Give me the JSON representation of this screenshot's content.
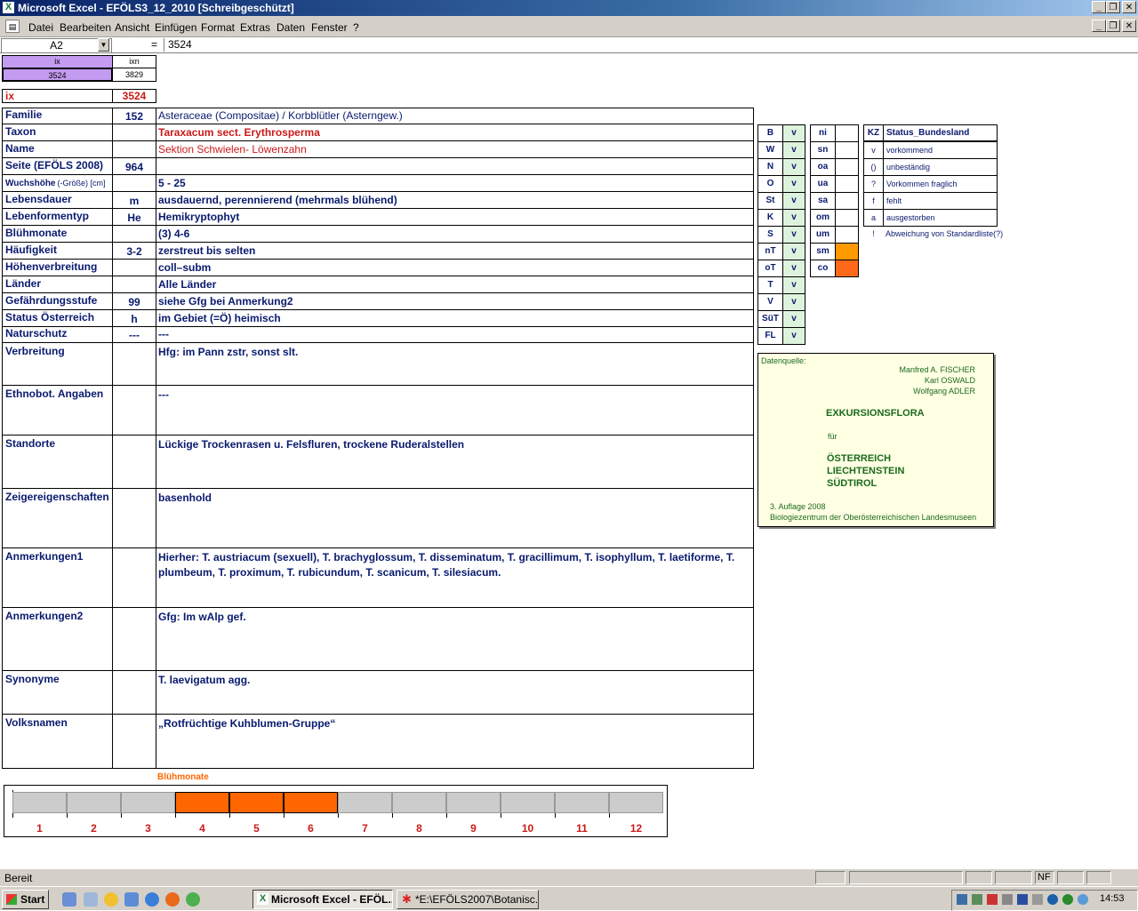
{
  "window": {
    "title": "Microsoft Excel - EFÖLS3_12_2010  [Schreibgeschützt]"
  },
  "menu": [
    "Datei",
    "Bearbeiten",
    "Ansicht",
    "Einfügen",
    "Format",
    "Extras",
    "Daten",
    "Fenster",
    "?"
  ],
  "formula_bar": {
    "name_box": "A2",
    "eq": "=",
    "value": "3524"
  },
  "index_box": {
    "h1": "ix",
    "h2": "ixn",
    "v1": "3524",
    "v2": "3829"
  },
  "ix_row": {
    "label": "ix",
    "value": "3524"
  },
  "rows": [
    {
      "label": "Familie",
      "code": "152",
      "value": "Asteraceae (Compositae)  /  Korbblütler (Asterngew.)"
    },
    {
      "label": "Taxon",
      "code": "",
      "value": "Taraxacum sect. Erythrosperma"
    },
    {
      "label": "Name",
      "code": "",
      "value": "Sektion Schwielen- Löwenzahn"
    },
    {
      "label": "Seite (EFÖLS 2008)",
      "code": "964",
      "value": ""
    },
    {
      "label": "Wuchshöhe",
      "label_suffix": "(-Größe) [cm]",
      "code": "",
      "value": " 5 - 25"
    },
    {
      "label": "Lebensdauer",
      "code": "m",
      "value": "ausdauernd, perennierend (mehrmals blühend)"
    },
    {
      "label": "Lebenformentyp",
      "code": "He",
      "value": "Hemikryptophyt"
    },
    {
      "label": "Blühmonate",
      "code": "",
      "value": "(3) 4-6"
    },
    {
      "label": "Häufigkeit",
      "code": "3-2",
      "value": "zerstreut bis selten"
    },
    {
      "label": "Höhenverbreitung",
      "code": "",
      "value": "coll–subm"
    },
    {
      "label": "Länder",
      "code": "",
      "value": "Alle Länder"
    },
    {
      "label": "Gefährdungsstufe",
      "code": "99",
      "value": "siehe Gfg bei Anmerkung2"
    },
    {
      "label": "Status Österreich",
      "code": "h",
      "value": "im Gebiet (=Ö) heimisch"
    },
    {
      "label": "Naturschutz",
      "code": "---",
      "value": "---"
    }
  ],
  "big_rows": [
    {
      "label": "Verbreitung",
      "value": "Hfg:  im Pann zstr, sonst slt."
    },
    {
      "label": "Ethnobot. Angaben",
      "value": "---"
    },
    {
      "label": "Standorte",
      "value": "Lückige Trockenrasen u. Felsfluren, trockene Ruderalstellen"
    },
    {
      "label": "Zeigereigenschaften",
      "value": "basenhold"
    },
    {
      "label": "Anmerkungen1",
      "value": "Hierher: T. austriacum (sexuell), T. brachyglossum, T. disseminatum, T. gracillimum, T. isophyllum, T. laetiforme, T.",
      "value2": "plumbeum, T. proximum, T. rubicundum, T. scanicum, T. silesiacum."
    },
    {
      "label": "Anmerkungen2",
      "value": "Gfg:  Im wAlp gef."
    },
    {
      "label": "Synonyme",
      "value": "T. laevigatum agg."
    },
    {
      "label": "Volksnamen",
      "value": "„Rotfrüchtige Kuhblumen-Gruppe“"
    }
  ],
  "status_left": [
    {
      "code": "B",
      "v": "v"
    },
    {
      "code": "W",
      "v": "v"
    },
    {
      "code": "N",
      "v": "v"
    },
    {
      "code": "O",
      "v": "v"
    },
    {
      "code": "St",
      "v": "v"
    },
    {
      "code": "K",
      "v": "v"
    },
    {
      "code": "S",
      "v": "v"
    },
    {
      "code": "nT",
      "v": "v"
    },
    {
      "code": "oT",
      "v": "v"
    },
    {
      "code": "T",
      "v": "v"
    },
    {
      "code": "V",
      "v": "v"
    },
    {
      "code": "SüT",
      "v": "v"
    },
    {
      "code": "FL",
      "v": "v"
    }
  ],
  "status_mid": [
    {
      "code": "ni",
      "fill": ""
    },
    {
      "code": "sn",
      "fill": ""
    },
    {
      "code": "oa",
      "fill": ""
    },
    {
      "code": "ua",
      "fill": ""
    },
    {
      "code": "sa",
      "fill": ""
    },
    {
      "code": "om",
      "fill": ""
    },
    {
      "code": "um",
      "fill": ""
    },
    {
      "code": "sm",
      "fill": "#ff9900"
    },
    {
      "code": "co",
      "fill": "#ff6a1a"
    }
  ],
  "legend": {
    "header_kz": "KZ",
    "header_title": "Status_Bundesland",
    "items": [
      {
        "k": "v",
        "t": "vorkommend"
      },
      {
        "k": "()",
        "t": "unbeständig"
      },
      {
        "k": "?",
        "t": "Vorkommen fraglich"
      },
      {
        "k": "f",
        "t": "fehlt"
      },
      {
        "k": "a",
        "t": "ausgestorben"
      },
      {
        "k": "!",
        "t": "Abweichung von Standardliste(?)"
      }
    ]
  },
  "source": {
    "label": "Datenquelle:",
    "authors": [
      "Manfred A. FISCHER",
      "Karl OSWALD",
      "Wolfgang ADLER"
    ],
    "title": "EXKURSIONSFLORA",
    "fuer": "für",
    "countries": [
      "ÖSTERREICH",
      "LIECHTENSTEIN",
      "SÜDTIROL"
    ],
    "edition": "3. Auflage 2008",
    "publisher": "Biologiezentrum der Oberösterreichischen Landesmuseen"
  },
  "bloom": {
    "title": "Blühmonate",
    "months": [
      "1",
      "2",
      "3",
      "4",
      "5",
      "6",
      "7",
      "8",
      "9",
      "10",
      "11",
      "12"
    ],
    "active": [
      false,
      false,
      false,
      true,
      true,
      true,
      false,
      false,
      false,
      false,
      false,
      false
    ],
    "colors": {
      "active": "#ff6600",
      "inactive": "#cccccc"
    }
  },
  "statusbar": {
    "text": "Bereit",
    "nf": "NF"
  },
  "taskbar": {
    "start": "Start",
    "tasks": [
      "Microsoft Excel - EFÖL...",
      "*E:\\EFÖLS2007\\Botanisc..."
    ],
    "time": "14:53"
  }
}
